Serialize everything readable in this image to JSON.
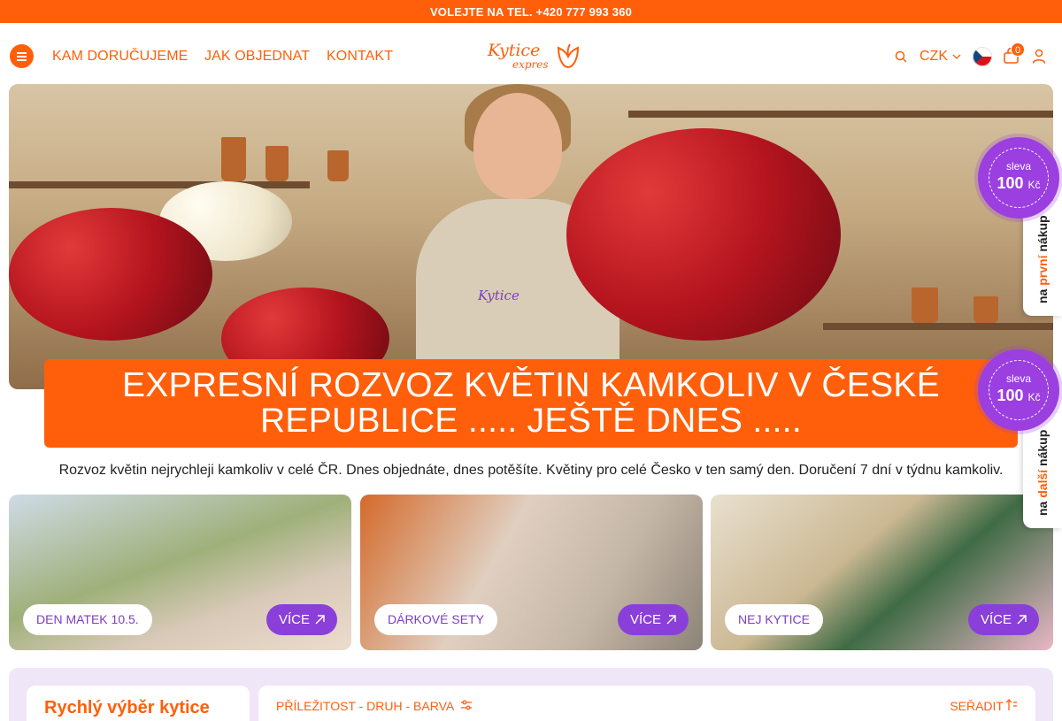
{
  "topbar": {
    "text": "VOLEJTE NA TEL. +420 777 993 360"
  },
  "nav": {
    "links": [
      "KAM DORUČUJEME",
      "JAK OBJEDNAT",
      "KONTAKT"
    ],
    "logo_line1": "Kytice",
    "logo_line2": "expres",
    "currency": "CZK",
    "cart_count": "0"
  },
  "hero": {
    "apron_logo": "Kytice",
    "banner_line1": "EXPRESNÍ ROZVOZ KVĚTIN KAMKOLIV V ČESKÉ",
    "banner_line2": "REPUBLICE ..... JEŠTĚ DNES ....."
  },
  "subtitle": "Rozvoz květin nejrychleji kamkoliv v celé ČR. Dnes objednáte, dnes potěšíte. Květiny pro celé Česko v ten samý den. Doručení 7 dní v týdnu kamkoliv.",
  "cards": [
    {
      "label": "DEN MATEK 10.5.",
      "button": "VÍCE"
    },
    {
      "label": "DÁRKOVÉ SETY",
      "button": "VÍCE"
    },
    {
      "label": "NEJ KYTICE",
      "button": "VÍCE"
    }
  ],
  "badges": [
    {
      "small": "sleva",
      "value": "100",
      "unit": "Kč",
      "pre": "na ",
      "highlight": "první",
      "post": " nákup"
    },
    {
      "small": "sleva",
      "value": "100",
      "unit": "Kč",
      "pre": "na ",
      "highlight": "další",
      "post": " nákup"
    }
  ],
  "filters": {
    "quick_title": "Rychlý výběr kytice",
    "filter_label": "PŘÍLEŽITOST - DRUH - BARVA",
    "sort_label": "SEŘADIT"
  },
  "colors": {
    "accent": "#ff5f0a",
    "purple": "#8b3fd9",
    "filter_bg": "#efe6f8"
  }
}
